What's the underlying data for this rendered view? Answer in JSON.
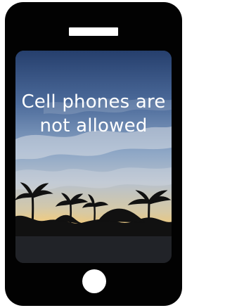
{
  "message": {
    "line1": "Cell phones are",
    "line2": "not allowed"
  },
  "icons": {
    "phone": "smartphone-outline",
    "scene": "palm-trees-sunset-photo"
  },
  "colors": {
    "phone_body": "#020202",
    "sky_top": "#27406f",
    "sky_mid": "#6f8fb8",
    "sky_low": "#b9c3cf",
    "horizon_glow": "#f2c777",
    "silhouette": "#121212",
    "text": "#ffffff"
  }
}
